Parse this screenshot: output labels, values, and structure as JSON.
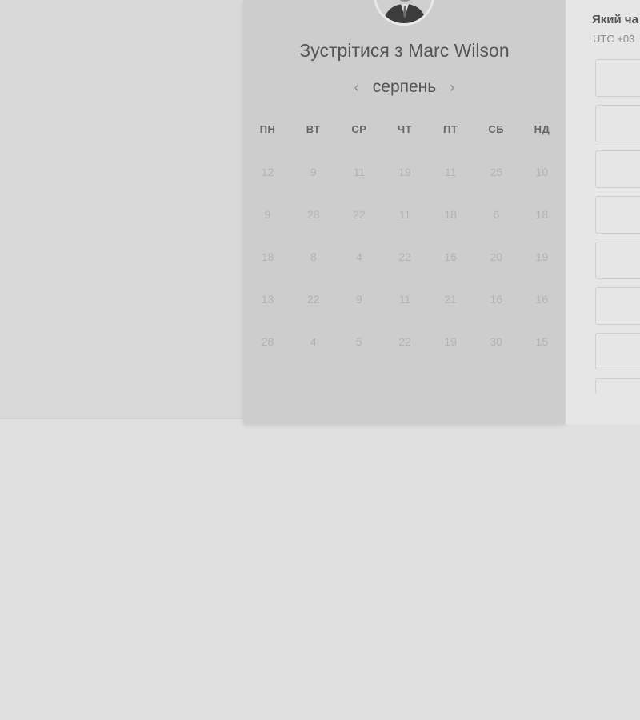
{
  "title": "Зустрітися з Marc Wilson",
  "calendar": {
    "month": "серпень",
    "prev_icon": "‹",
    "next_icon": "›",
    "weekdays": [
      "ПН",
      "ВТ",
      "СР",
      "ЧТ",
      "ПТ",
      "СБ",
      "НД"
    ],
    "weeks": [
      [
        "12",
        "9",
        "11",
        "19",
        "11",
        "25",
        "10"
      ],
      [
        "9",
        "28",
        "22",
        "11",
        "18",
        "6",
        "18"
      ],
      [
        "18",
        "8",
        "4",
        "22",
        "16",
        "20",
        "19"
      ],
      [
        "13",
        "22",
        "9",
        "11",
        "21",
        "16",
        "16"
      ],
      [
        "28",
        "4",
        "5",
        "22",
        "19",
        "30",
        "15"
      ]
    ]
  },
  "time_panel": {
    "question": "Який ча",
    "timezone": "UTC +03"
  }
}
